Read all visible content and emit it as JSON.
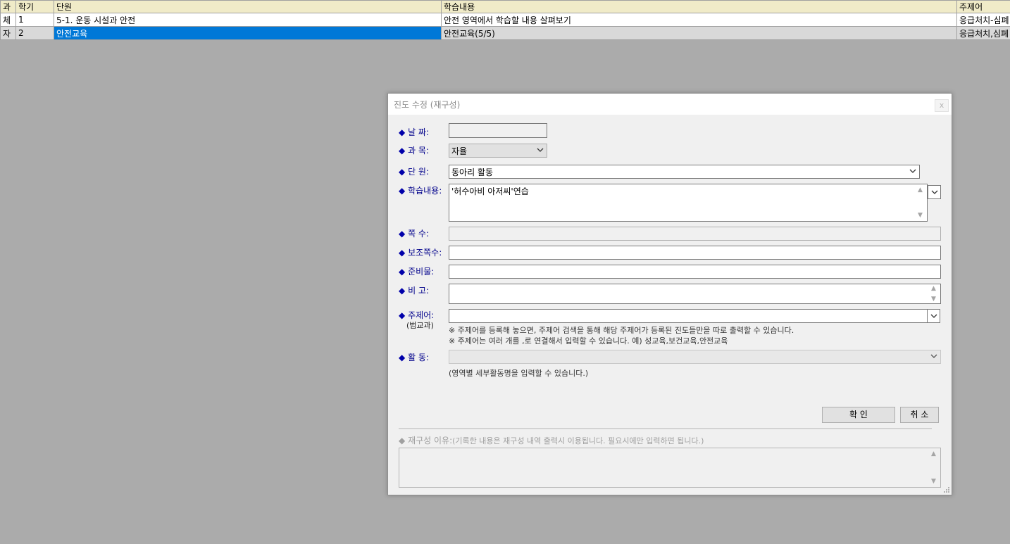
{
  "grid": {
    "headers": [
      "과",
      "학기",
      "단원",
      "학습내용",
      "주제어"
    ],
    "rows": [
      [
        "체",
        "1",
        "5-1. 운동 시설과 안전",
        "안전 영역에서 학습할 내용 살펴보기",
        "응급처치-심폐"
      ],
      [
        "자",
        "2",
        "안전교육",
        "안전교육(5/5)",
        "응급처치,심폐"
      ]
    ]
  },
  "dialog": {
    "title": "진도 수정 (재구성)",
    "close_label": "x",
    "labels": {
      "date": "날 짜:",
      "subject": "과 목:",
      "unit": "단 원:",
      "content": "학습내용:",
      "page": "쪽 수:",
      "sub_page": "보조쪽수:",
      "materials": "준비물:",
      "remarks": "비 고:",
      "keyword": "주제어:",
      "keyword_sub": "(범교과)",
      "activity": "활 동:"
    },
    "bullet": "◆",
    "values": {
      "date": "",
      "subject": "자율",
      "unit": "동아리 활동",
      "content": "'허수아비 아저씨'연습",
      "page": "",
      "sub_page": "",
      "materials": "",
      "remarks": "",
      "keyword": "",
      "activity": ""
    },
    "notes": {
      "keyword_1": "※ 주제어를 등록해 놓으면, 주제어 검색을 통해 해당 주제어가 등록된 진도들만을 따로 출력할 수 있습니다.",
      "keyword_2": "※ 주제어는 여러 개를 ,로 연결해서 입력할 수 있습니다.  예) 성교육,보건교육,안전교육",
      "activity": "(영역별 세부활동명을 입력할 수 있습니다.)"
    },
    "buttons": {
      "ok": "확 인",
      "cancel": "취 소"
    },
    "reason": {
      "label": "재구성 이유:",
      "hint": "(기록한 내용은 재구성 내역 출력시 이용됩니다. 필요시에만 입력하면 됩니다.)",
      "value": ""
    }
  },
  "icons": {
    "bullet": "diamond-bullet-icon",
    "dropdown": "chevron-down-icon",
    "scroll_up": "scroll-up-arrow-icon",
    "scroll_down": "scroll-down-arrow-icon",
    "close": "close-icon",
    "resize": "resize-grip-icon"
  },
  "colors": {
    "background": "#ababab",
    "header_bg": "#f0ebc8",
    "selection": "#0078d7",
    "label_blue": "#00008b"
  }
}
